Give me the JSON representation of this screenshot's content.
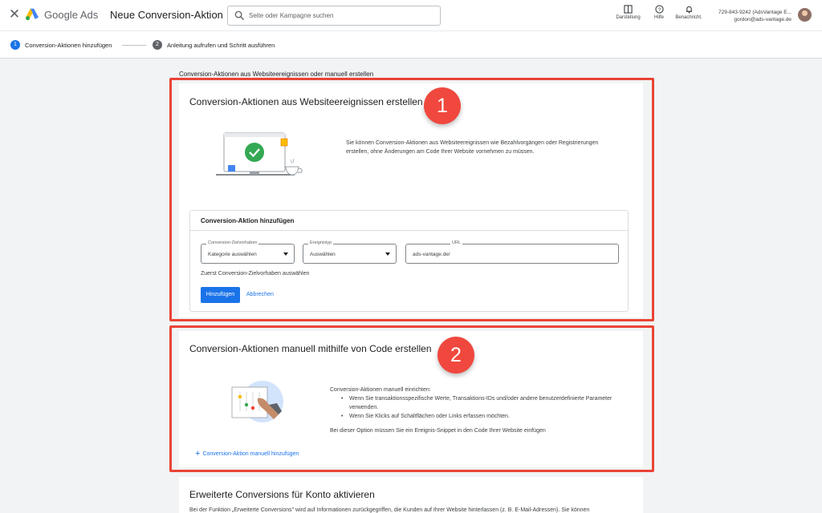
{
  "header": {
    "brand": "Google Ads",
    "page_title": "Neue Conversion-Aktion",
    "search_placeholder": "Seite oder Kampagne suchen",
    "icons": [
      {
        "label": "Darstellung",
        "icon": "appearance-icon"
      },
      {
        "label": "Hilfe",
        "icon": "help-icon"
      },
      {
        "label": "Benachricht.",
        "icon": "bell-icon"
      }
    ],
    "account_line1": "729-843-9242 (AdsVantage E...",
    "account_line2": "gordon@ads-vantage.de"
  },
  "stepper": {
    "steps": [
      {
        "number": "1",
        "label": "Conversion-Aktionen hinzufügen"
      },
      {
        "number": "2",
        "label": "Anleitung aufrufen und Schritt ausführen"
      }
    ]
  },
  "section_heading": "Conversion-Aktionen aus Websiteereignissen oder manuell erstellen",
  "card1": {
    "title": "Conversion-Aktionen aus Websiteereignissen erstellen",
    "badge": "1",
    "description": "Sie können Conversion-Aktionen aus Websiteereignissen wie Bezahlvorgängen oder Registrierungen erstellen, ohne Änderungen am Code Ihrer Website vornehmen zu müssen.",
    "form": {
      "title": "Conversion-Aktion hinzufügen",
      "goal_label": "Conversion-Zielvorhaben",
      "goal_value": "Kategorie auswählen",
      "event_label": "Ereignistyp",
      "event_value": "Auswählen",
      "url_label": "URL",
      "url_value": "ads-vantage.de/",
      "hint": "Zuerst Conversion-Zielvorhaben auswählen",
      "add_button": "Hinzufügen",
      "cancel_button": "Abbrechen"
    }
  },
  "card2": {
    "title": "Conversion-Aktionen manuell mithilfe von Code erstellen",
    "badge": "2",
    "intro": "Conversion-Aktionen manuell einrichten:",
    "bullets": [
      "Wenn Sie transaktionsspezifische Werte, Transaktions-IDs und/oder andere benutzerdefinierte Parameter verwenden.",
      "Wenn Sie Klicks auf Schaltflächen oder Links erfassen möchten."
    ],
    "note": "Bei dieser Option müssen Sie ein Ereignis-Snippet in den Code Ihrer Website einfügen",
    "add_link": "Conversion-Aktion manuell hinzufügen"
  },
  "card3": {
    "title": "Erweiterte Conversions für Konto aktivieren",
    "text": "Bei der Funktion „Erweiterte Conversions\" wird auf Informationen zurückgegriffen, die Kunden auf Ihrer Website hinterlassen (z. B. E-Mail-Adressen). Sie können"
  },
  "colors": {
    "accent": "#1a73e8",
    "highlight": "#ea4335",
    "badge": "#f0483e"
  }
}
